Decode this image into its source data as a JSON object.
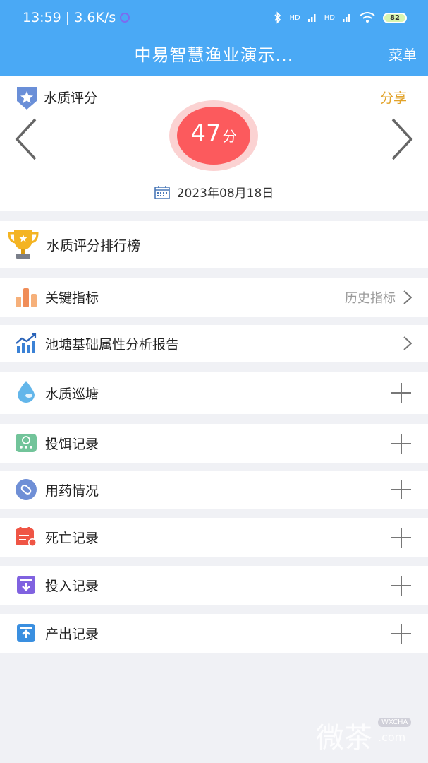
{
  "status_bar": {
    "time_speed": "13:59 | 3.6K/s",
    "battery": "82",
    "hd1": "HD",
    "hd2": "HD"
  },
  "nav": {
    "title": "中易智慧渔业演示...",
    "menu_label": "菜单"
  },
  "score_card": {
    "title": "水质评分",
    "share_label": "分享",
    "score_value": "47",
    "score_unit": "分",
    "date": "2023年08月18日"
  },
  "rows": {
    "ranking": {
      "label": "水质评分排行榜"
    },
    "key_indicators": {
      "label": "关键指标",
      "right_text": "历史指标"
    },
    "pond_report": {
      "label": "池塘基础属性分析报告"
    },
    "water_patrol": {
      "label": "水质巡塘"
    },
    "feeding": {
      "label": "投饵记录"
    },
    "medication": {
      "label": "用药情况"
    },
    "death": {
      "label": "死亡记录"
    },
    "input": {
      "label": "投入记录"
    },
    "output": {
      "label": "产出记录"
    }
  },
  "watermark": {
    "main": "微茶",
    "sub": "WXCHA",
    "com": ".com"
  },
  "colors": {
    "primary": "#4aa9f5",
    "score": "#fc5a5d",
    "share": "#e2a32a"
  }
}
